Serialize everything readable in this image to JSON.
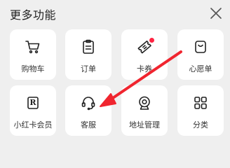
{
  "panel": {
    "title": "更多功能",
    "close_icon": "close-icon"
  },
  "items": [
    {
      "label": "购物车",
      "icon": "shopping-cart-icon"
    },
    {
      "label": "订单",
      "icon": "order-clipboard-icon"
    },
    {
      "label": "卡券",
      "icon": "coupon-icon",
      "badge_dot": true
    },
    {
      "label": "心愿单",
      "icon": "wishlist-bag-icon"
    },
    {
      "label": "小红卡会员",
      "icon": "red-card-member-icon",
      "icon_text": "R"
    },
    {
      "label": "客服",
      "icon": "customer-service-headset-icon"
    },
    {
      "label": "地址管理",
      "icon": "address-camera-icon"
    },
    {
      "label": "分类",
      "icon": "category-grid-icon"
    }
  ],
  "annotation": {
    "arrow_color": "#f0252f",
    "points_to": "客服"
  },
  "colors": {
    "background": "#efefef",
    "tile": "#ffffff",
    "accent": "#ff2442",
    "text": "#333333"
  }
}
